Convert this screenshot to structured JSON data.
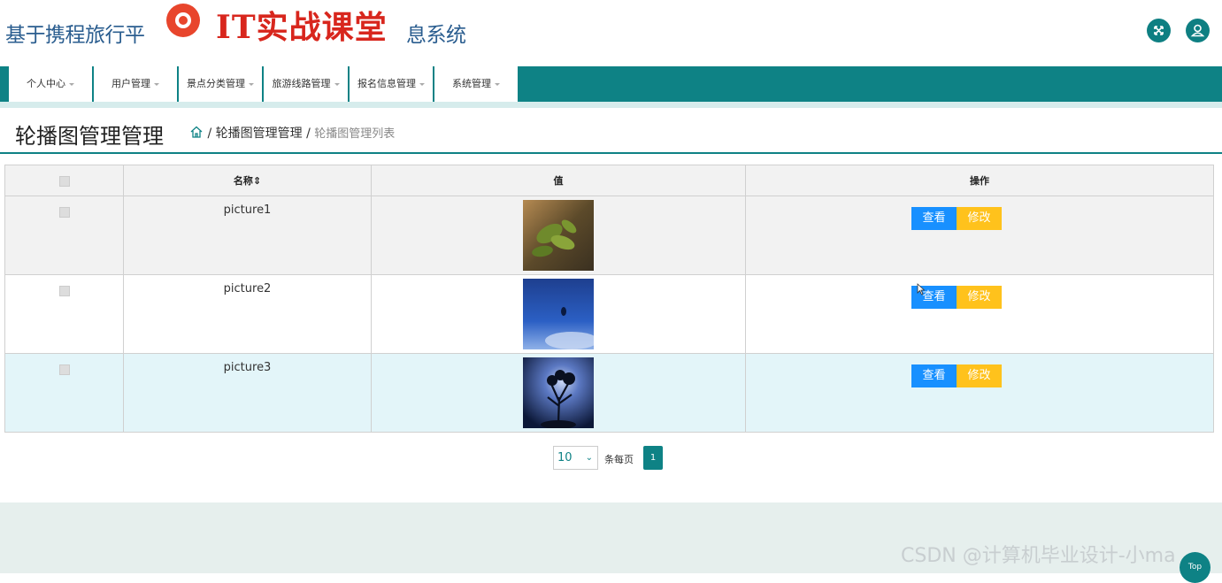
{
  "header": {
    "title_part1": "基于携程旅行平",
    "title_part2": "息系统",
    "overlay_logo_text": "IT实战课堂",
    "icons": [
      "fullscreen-icon",
      "user-icon"
    ]
  },
  "nav": {
    "items": [
      {
        "label": "个人中心"
      },
      {
        "label": "用户管理"
      },
      {
        "label": "景点分类管理"
      },
      {
        "label": "旅游线路管理"
      },
      {
        "label": "报名信息管理"
      },
      {
        "label": "系统管理"
      }
    ]
  },
  "page": {
    "title": "轮播图管理管理",
    "breadcrumb": {
      "sep": "/",
      "section": "轮播图管理管理",
      "current": "轮播图管理列表"
    }
  },
  "table": {
    "columns": {
      "name": "名称",
      "sort_glyph": "⇕",
      "value": "值",
      "actions": "操作"
    },
    "rows": [
      {
        "name": "picture1",
        "image": "plant-leaves-photo",
        "view": "查看",
        "edit": "修改"
      },
      {
        "name": "picture2",
        "image": "blue-sky-photo",
        "view": "查看",
        "edit": "修改"
      },
      {
        "name": "picture3",
        "image": "tree-moon-photo",
        "view": "查看",
        "edit": "修改"
      }
    ]
  },
  "pagination": {
    "page_size": "10",
    "per_page_label": "条每页",
    "current_page": "1"
  },
  "footer": {
    "watermark": "CSDN @计算机毕业设计-小ma",
    "top_label": "Top"
  },
  "colors": {
    "primary": "#0e8285",
    "view_button": "#1890ff",
    "edit_button": "#ffc21c",
    "title_blue": "#2a5d8f"
  }
}
